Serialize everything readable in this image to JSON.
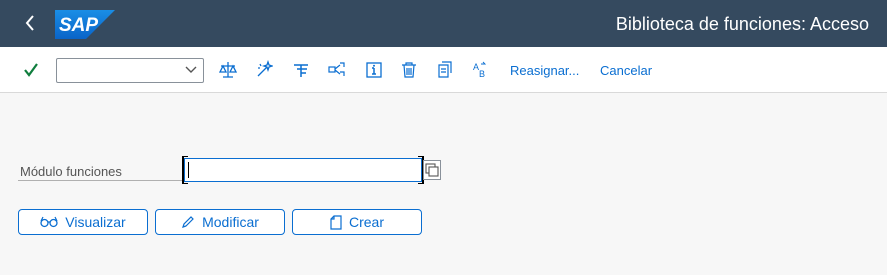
{
  "shell": {
    "title": "Biblioteca de funciones: Acceso",
    "logo_text": "SAP",
    "back_icon": "chevron-left-icon"
  },
  "toolbar": {
    "command_field_value": "",
    "icons": [
      "checkmark-icon",
      "balance-scale-icon",
      "magic-wand-icon",
      "hierarchy-icon",
      "where-used-icon",
      "info-icon",
      "trash-icon",
      "copy-icon",
      "rename-icon"
    ],
    "reassign_label": "Reasignar...",
    "cancel_label": "Cancelar"
  },
  "form": {
    "module_label": "Módulo funciones",
    "module_value": ""
  },
  "buttons": {
    "display_label": "Visualizar",
    "change_label": "Modificar",
    "create_label": "Crear"
  },
  "colors": {
    "shell_bg": "#354a5f",
    "accent": "#0a6ed1",
    "check": "#107e3e",
    "logo_blue": "#0a70d5"
  }
}
